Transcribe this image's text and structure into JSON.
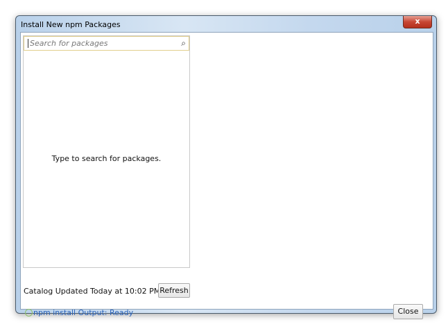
{
  "window": {
    "title": "Install New npm Packages",
    "close_glyph": "x"
  },
  "search": {
    "placeholder": "Search for packages"
  },
  "list": {
    "empty_text": "Type to search for packages."
  },
  "catalog": {
    "status": "Catalog Updated Today at 10:02 PM",
    "refresh_label": "Refresh"
  },
  "footer": {
    "status": "npm install Output: Ready",
    "close_label": "Close"
  }
}
